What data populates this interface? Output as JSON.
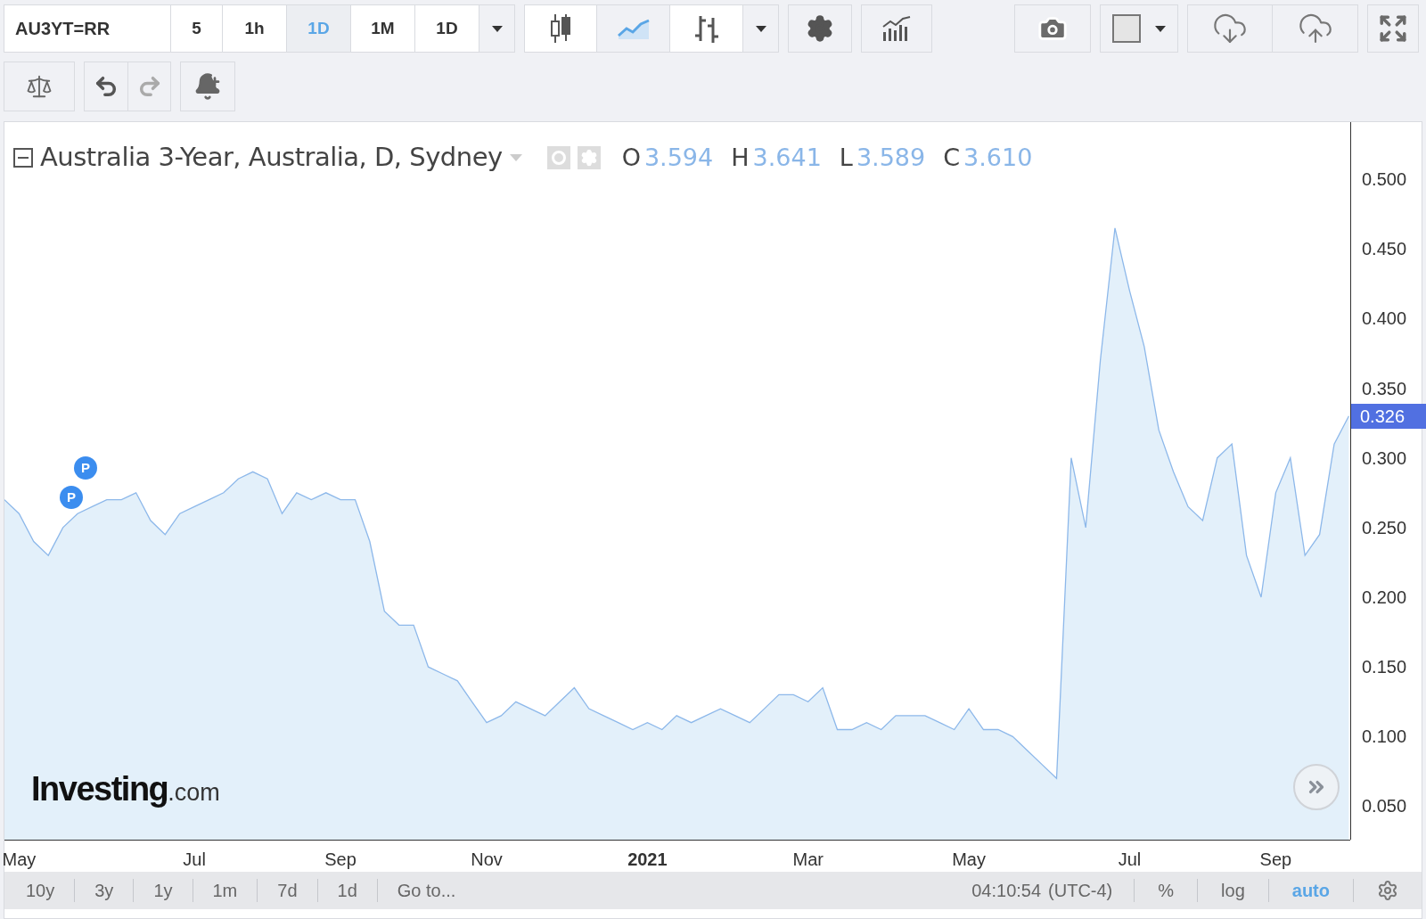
{
  "toolbar": {
    "symbol": "AU3YT=RR",
    "intervals": [
      {
        "label": "5",
        "selected": false
      },
      {
        "label": "1h",
        "selected": false
      },
      {
        "label": "1D",
        "selected": true
      },
      {
        "label": "1M",
        "selected": false
      },
      {
        "label": "1D",
        "selected": false
      }
    ],
    "chart_types": [
      {
        "kind": "candles",
        "selected": false
      },
      {
        "kind": "area",
        "selected": true
      },
      {
        "kind": "bars",
        "selected": false
      }
    ]
  },
  "second_row": {
    "redo_disabled": true
  },
  "legend": {
    "title": "Australia 3-Year, Australia, D, Sydney",
    "ohlc": [
      {
        "key": "O",
        "value": "3.594"
      },
      {
        "key": "H",
        "value": "3.641"
      },
      {
        "key": "L",
        "value": "3.589"
      },
      {
        "key": "C",
        "value": "3.610"
      }
    ]
  },
  "markers": [
    {
      "label": "P"
    },
    {
      "label": "P"
    }
  ],
  "logo": {
    "name": "Investing",
    "suffix": ".com"
  },
  "last_price": "0.326",
  "chart_data": {
    "type": "area",
    "categories": [
      null,
      "May",
      null,
      null,
      null,
      null,
      null,
      null,
      null,
      null,
      null,
      null,
      null,
      "Jul",
      null,
      null,
      null,
      null,
      null,
      null,
      null,
      null,
      null,
      "Sep",
      null,
      null,
      null,
      null,
      null,
      null,
      null,
      null,
      null,
      "Nov",
      null,
      null,
      null,
      null,
      null,
      null,
      null,
      null,
      null,
      null,
      "2021",
      null,
      null,
      null,
      null,
      null,
      null,
      null,
      null,
      null,
      null,
      "Mar",
      null,
      null,
      null,
      null,
      null,
      null,
      null,
      null,
      null,
      null,
      "May",
      null,
      null,
      null,
      null,
      null,
      null,
      null,
      null,
      null,
      null,
      "Jul",
      null,
      null,
      null,
      null,
      null,
      null,
      null,
      null,
      null,
      "Sep",
      null,
      null,
      null,
      null,
      null
    ],
    "series": [
      {
        "color": "#8db8ea",
        "values": [
          0.27,
          0.26,
          0.24,
          0.23,
          0.25,
          0.26,
          0.265,
          0.27,
          0.27,
          0.275,
          0.255,
          0.245,
          0.26,
          0.265,
          0.27,
          0.275,
          0.285,
          0.29,
          0.285,
          0.26,
          0.275,
          0.27,
          0.275,
          0.27,
          0.27,
          0.24,
          0.19,
          0.18,
          0.18,
          0.15,
          0.145,
          0.14,
          0.125,
          0.11,
          0.115,
          0.125,
          0.12,
          0.115,
          0.125,
          0.135,
          0.12,
          0.115,
          0.11,
          0.105,
          0.11,
          0.105,
          0.115,
          0.11,
          0.115,
          0.12,
          0.115,
          0.11,
          0.12,
          0.13,
          0.13,
          0.125,
          0.135,
          0.105,
          0.105,
          0.11,
          0.105,
          0.115,
          0.115,
          0.115,
          0.11,
          0.105,
          0.12,
          0.105,
          0.105,
          0.1,
          0.09,
          0.08,
          0.07,
          0.3,
          0.25,
          0.37,
          0.465,
          0.42,
          0.38,
          0.32,
          0.29,
          0.265,
          0.255,
          0.3,
          0.31,
          0.23,
          0.2,
          0.275,
          0.3,
          0.23,
          0.245,
          0.31,
          0.33
        ]
      }
    ],
    "ylim": [
      0.026,
      0.541
    ],
    "yticks": [
      {
        "value": 0.05,
        "label": "0.050"
      },
      {
        "value": 0.1,
        "label": "0.100"
      },
      {
        "value": 0.15,
        "label": "0.150"
      },
      {
        "value": 0.2,
        "label": "0.200"
      },
      {
        "value": 0.25,
        "label": "0.250"
      },
      {
        "value": 0.3,
        "label": "0.300"
      },
      {
        "value": 0.35,
        "label": "0.350"
      },
      {
        "value": 0.4,
        "label": "0.400"
      },
      {
        "value": 0.45,
        "label": "0.450"
      },
      {
        "value": 0.5,
        "label": "0.500"
      }
    ]
  },
  "bottom_bar": {
    "ranges": [
      "10y",
      "3y",
      "1y",
      "1m",
      "7d",
      "1d",
      "Go to..."
    ],
    "time": "04:10:54",
    "timezone": "(UTC-4)",
    "scale_options": [
      {
        "label": "%",
        "selected": false
      },
      {
        "label": "log",
        "selected": false
      },
      {
        "label": "auto",
        "selected": true
      }
    ]
  }
}
